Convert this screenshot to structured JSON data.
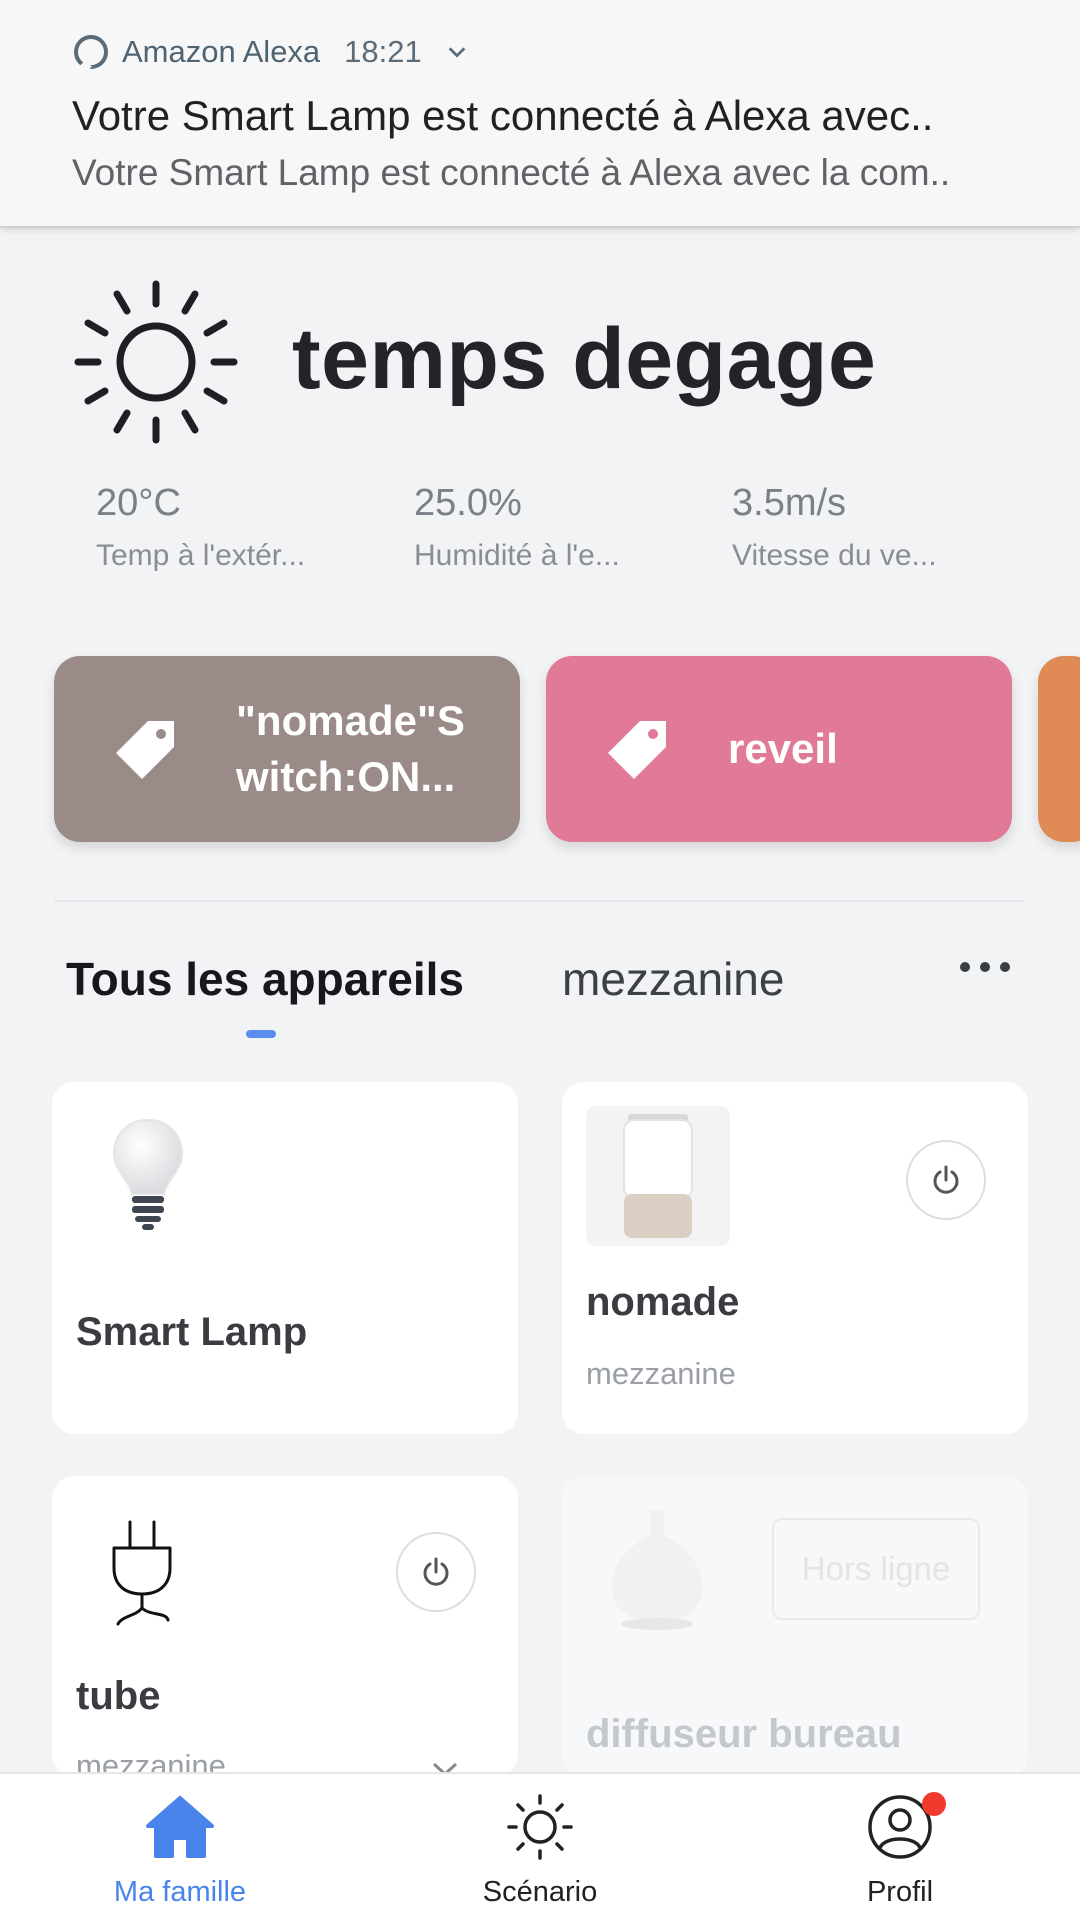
{
  "notification": {
    "app_name": "Amazon Alexa",
    "time": "18:21",
    "title": "Votre Smart Lamp est connecté à Alexa avec..",
    "body": "Votre Smart Lamp est connecté à Alexa avec la com.."
  },
  "weather": {
    "condition": "temps degage",
    "stats": [
      {
        "value": "20°C",
        "label": "Temp à l'extér..."
      },
      {
        "value": "25.0%",
        "label": "Humidité à l'e..."
      },
      {
        "value": "3.5m/s",
        "label": "Vitesse du ve..."
      }
    ]
  },
  "scenes": [
    {
      "label": "\"nomade\"Switch:ON...",
      "color": "#9b8b88"
    },
    {
      "label": "reveil",
      "color": "#e07a96"
    },
    {
      "label": "",
      "color": "#e08a55"
    }
  ],
  "tabs": [
    {
      "label": "Tous les appareils",
      "active": true
    },
    {
      "label": "mezzanine",
      "active": false
    }
  ],
  "devices": [
    {
      "name": "Smart Lamp",
      "room": "",
      "icon": "light-bulb-icon"
    },
    {
      "name": "nomade",
      "room": "mezzanine",
      "icon": "humidifier-icon"
    },
    {
      "name": "tube",
      "room": "mezzanine",
      "icon": "plug-icon"
    },
    {
      "name": "diffuseur bureau",
      "room": "",
      "status": "Hors ligne",
      "icon": "diffuser-icon"
    }
  ],
  "bottom_nav": [
    {
      "label": "Ma famille",
      "active": true
    },
    {
      "label": "Scénario",
      "active": false
    },
    {
      "label": "Profil",
      "active": false,
      "badge": true
    }
  ],
  "colors": {
    "accent": "#4a84ea",
    "badge": "#f1392e"
  }
}
